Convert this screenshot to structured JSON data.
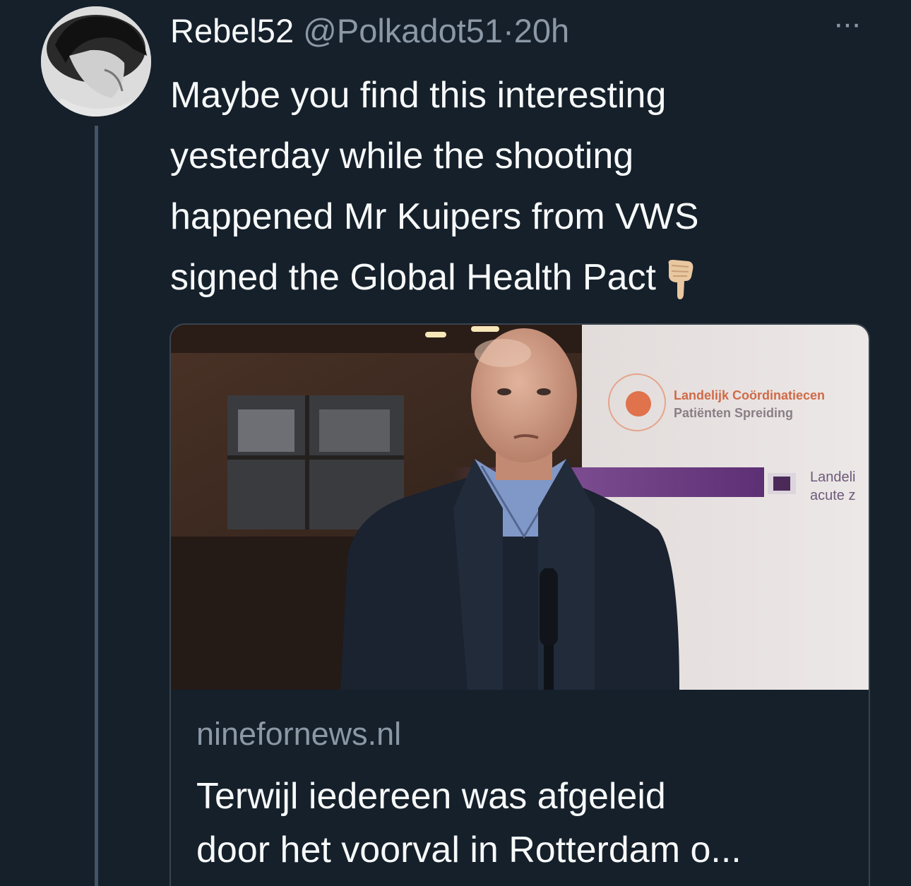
{
  "tweet": {
    "display_name": "Rebel52",
    "handle": "@Polkadot51",
    "separator": "·",
    "time": "20h",
    "more_label": "···",
    "body_lines": [
      "Maybe you find this interesting",
      "yesterday while the shooting",
      "happened Mr Kuipers from VWS",
      "signed the Global Health Pact"
    ],
    "emoji": "backhand-index-pointing-down"
  },
  "card": {
    "domain": "ninefornews.nl",
    "title_lines": [
      "Terwijl iedereen was afgeleid",
      "door het voorval in Rotterdam o..."
    ],
    "image": {
      "sign_line_1": "Landelijk Coördinatiecen",
      "sign_line_2": "Patiënten Spreiding",
      "sign_line_3": "Landeli",
      "sign_line_4": "acute z"
    }
  },
  "colors": {
    "background": "#15202b",
    "text": "#f7f9f9",
    "secondary": "#8b98a5",
    "border": "#38444d",
    "thread": "#425466"
  }
}
